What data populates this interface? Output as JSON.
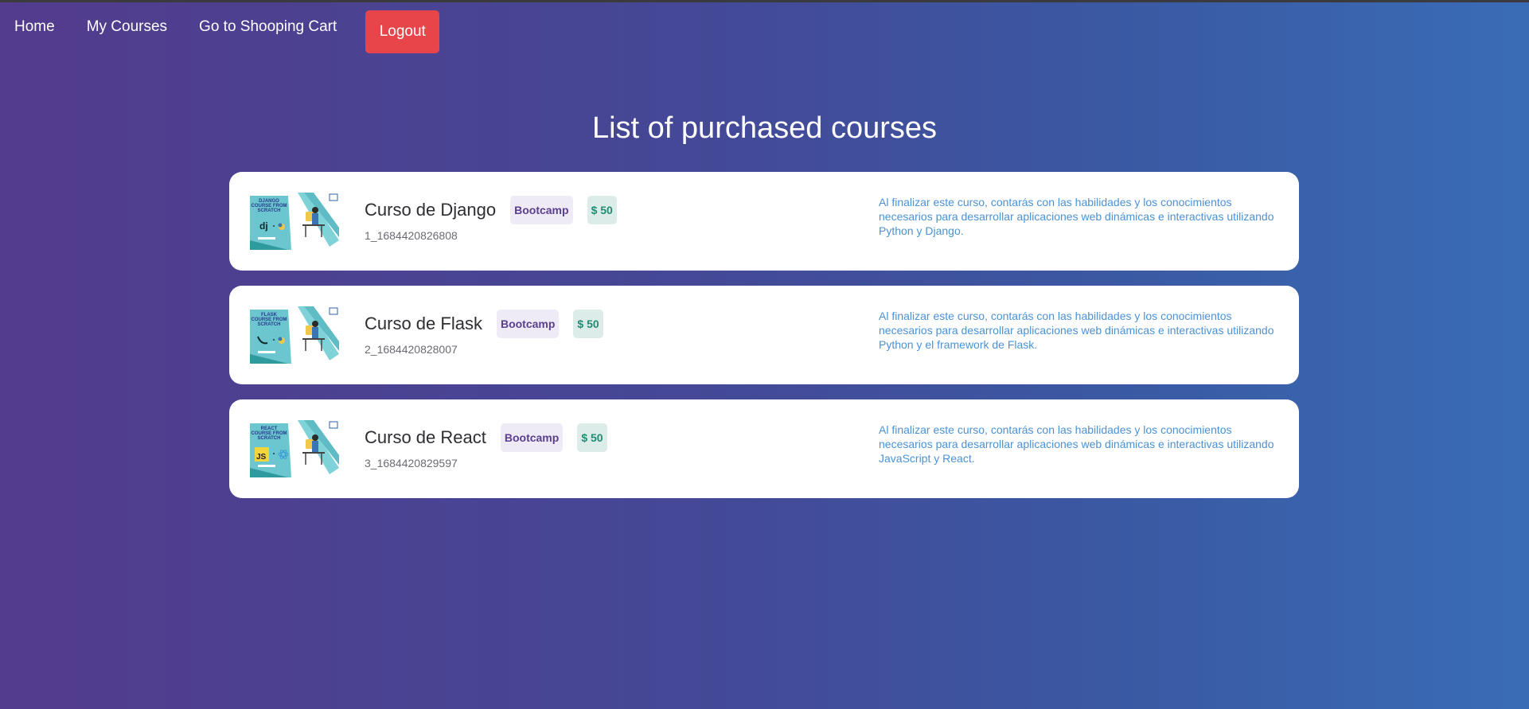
{
  "nav": {
    "home_label": "Home",
    "my_courses_label": "My Courses",
    "cart_label": "Go to Shooping Cart",
    "logout_label": "Logout"
  },
  "page": {
    "title": "List of purchased courses"
  },
  "colors": {
    "logout_bg": "#e8454b",
    "category_badge_text": "#5a3e8f",
    "price_badge_text": "#1f8d74",
    "description_text": "#4b92d6"
  },
  "courses": [
    {
      "name": "Curso de Django",
      "category": "Bootcamp",
      "price": "$ 50",
      "id": "1_1684420826808",
      "description": "Al finalizar este curso, contarás con las habilidades y los conocimientos necesarios para desarrollar aplicaciones web dinámicas e interactivas utilizando Python y Django.",
      "thumb_text": [
        "DJANGO",
        "COURSE FROM",
        "SCRATCH"
      ],
      "thumb_logo": "dj",
      "thumb_icon": "django-python-thumbnail"
    },
    {
      "name": "Curso de Flask",
      "category": "Bootcamp",
      "price": "$ 50",
      "id": "2_1684420828007",
      "description": "Al finalizar este curso, contarás con las habilidades y los conocimientos necesarios para desarrollar aplicaciones web dinámicas e interactivas utilizando Python y el framework de Flask.",
      "thumb_text": [
        "FLASK",
        "COURSE FROM",
        "SCRATCH"
      ],
      "thumb_logo": "",
      "thumb_icon": "flask-python-thumbnail"
    },
    {
      "name": "Curso de React",
      "category": "Bootcamp",
      "price": "$ 50",
      "id": "3_1684420829597",
      "description": "Al finalizar este curso, contarás con las habilidades y los conocimientos necesarios para desarrollar aplicaciones web dinámicas e interactivas utilizando JavaScript y React.",
      "thumb_text": [
        "REACT",
        "COURSE FROM",
        "SCRATCH"
      ],
      "thumb_logo": "JS",
      "thumb_icon": "react-js-thumbnail"
    }
  ]
}
